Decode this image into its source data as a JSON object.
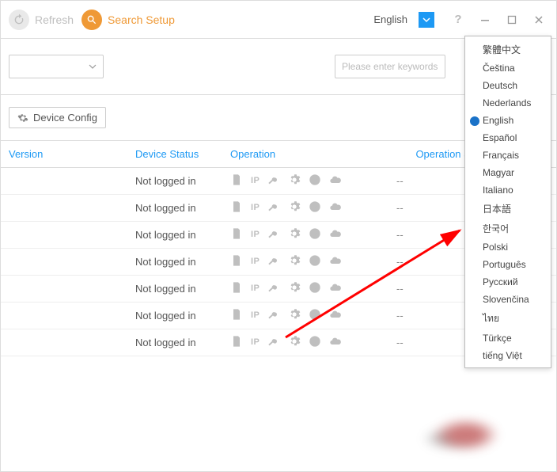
{
  "topbar": {
    "refresh_label": "Refresh",
    "search_setup_label": "Search Setup",
    "language_label": "English"
  },
  "secondbar": {
    "keywords_placeholder": "Please enter keywords"
  },
  "config": {
    "device_config_label": "Device Config"
  },
  "table": {
    "headers": {
      "version": "Version",
      "device_status": "Device Status",
      "operation": "Operation",
      "operation_status": "Operation Status"
    },
    "rows": [
      {
        "status": "Not logged in",
        "opstat": "--"
      },
      {
        "status": "Not logged in",
        "opstat": "--"
      },
      {
        "status": "Not logged in",
        "opstat": "--"
      },
      {
        "status": "Not logged in",
        "opstat": "--"
      },
      {
        "status": "Not logged in",
        "opstat": "--"
      },
      {
        "status": "Not logged in",
        "opstat": "--"
      },
      {
        "status": "Not logged in",
        "opstat": "--"
      }
    ],
    "op_icons": [
      "doc",
      "ip",
      "key",
      "gear",
      "browser",
      "cloud"
    ]
  },
  "languages": {
    "selected": "English",
    "items": [
      "繁體中文",
      "Čeština",
      "Deutsch",
      "Nederlands",
      "English",
      "Español",
      "Français",
      "Magyar",
      "Italiano",
      "日本語",
      "한국어",
      "Polski",
      "Português",
      "Русский",
      "Slovenčina",
      "ไทย",
      "Türkçe",
      "tiếng Việt"
    ]
  }
}
